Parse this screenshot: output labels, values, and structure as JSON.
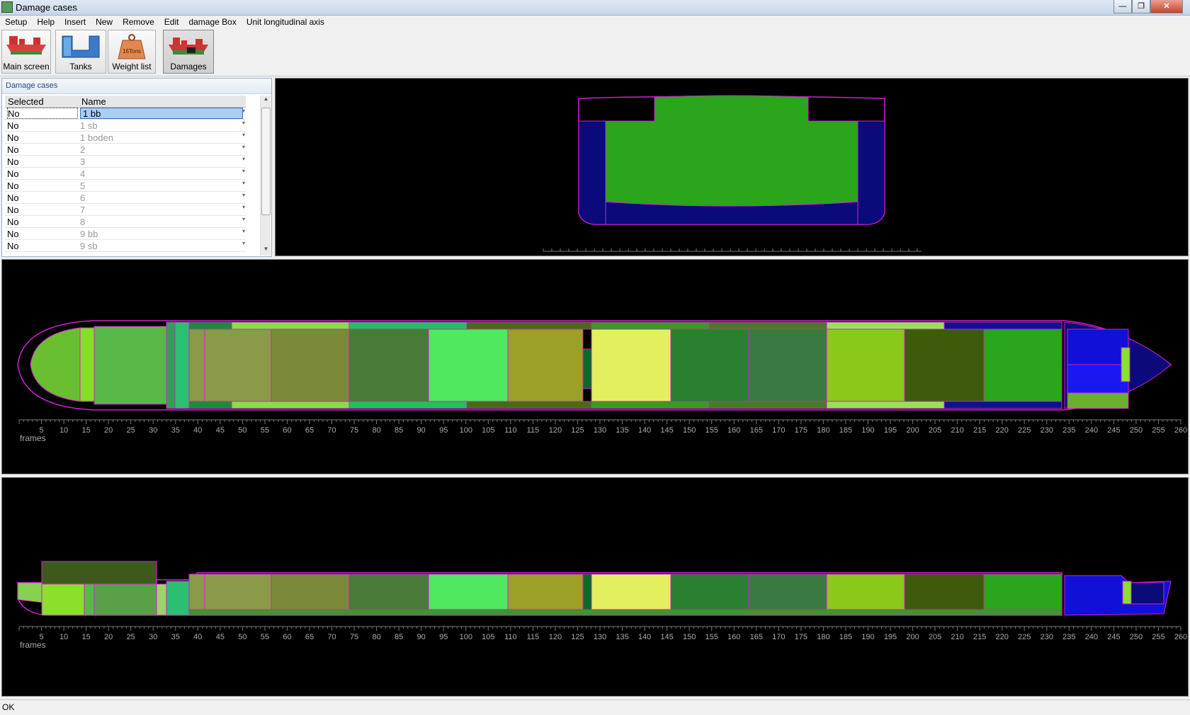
{
  "window": {
    "title": "Damage cases",
    "title_detail": "...",
    "minimize": "—",
    "maximize": "❐",
    "close": "✕"
  },
  "menu": [
    "Setup",
    "Help",
    "Insert",
    "New",
    "Remove",
    "Edit",
    "damage Box",
    "Unit longitudinal axis"
  ],
  "toolbar": {
    "buttons": [
      {
        "label": "Main screen",
        "icon": "ship-icon"
      },
      {
        "label": "Tanks",
        "icon": "tanks-icon"
      },
      {
        "label": "Weight list",
        "icon": "weight-icon",
        "badge": "16Tons"
      },
      {
        "label": "Damages",
        "icon": "damaged-ship-icon",
        "active": true
      }
    ]
  },
  "damage_panel": {
    "title": "Damage cases",
    "columns": [
      "Selected",
      "Name"
    ],
    "rows": [
      {
        "selected": "No",
        "name": "1 bb",
        "highlight": true
      },
      {
        "selected": "No",
        "name": "1 sb"
      },
      {
        "selected": "No",
        "name": "1 boden"
      },
      {
        "selected": "No",
        "name": "2"
      },
      {
        "selected": "No",
        "name": "3"
      },
      {
        "selected": "No",
        "name": "4"
      },
      {
        "selected": "No",
        "name": "5"
      },
      {
        "selected": "No",
        "name": "6"
      },
      {
        "selected": "No",
        "name": "7"
      },
      {
        "selected": "No",
        "name": "8"
      },
      {
        "selected": "No",
        "name": "9 bb"
      },
      {
        "selected": "No",
        "name": "9 sb"
      }
    ]
  },
  "plan_view": {
    "axis_label": "frames",
    "ticks": [
      5,
      10,
      15,
      20,
      25,
      30,
      35,
      40,
      45,
      50,
      55,
      60,
      65,
      70,
      75,
      80,
      85,
      90,
      95,
      100,
      105,
      110,
      115,
      120,
      125,
      130,
      135,
      140,
      145,
      150,
      155,
      160,
      165,
      170,
      175,
      180,
      185,
      190,
      195,
      200,
      205,
      210,
      215,
      220,
      225,
      230,
      235,
      240,
      245,
      250,
      255,
      260
    ]
  },
  "profile_view": {
    "axis_label": "frames",
    "ticks": [
      5,
      10,
      15,
      20,
      25,
      30,
      35,
      40,
      45,
      50,
      55,
      60,
      65,
      70,
      75,
      80,
      85,
      90,
      95,
      100,
      105,
      110,
      115,
      120,
      125,
      130,
      135,
      140,
      145,
      150,
      155,
      160,
      165,
      170,
      175,
      180,
      185,
      190,
      195,
      200,
      205,
      210,
      215,
      220,
      225,
      230,
      235,
      240,
      245,
      250,
      255,
      260
    ]
  },
  "colors": {
    "hull_outline": "#d020d0",
    "background": "#000000",
    "cargo_green": "#2aa51c",
    "ballast_blue": "#0a0a7a"
  },
  "status": "OK"
}
